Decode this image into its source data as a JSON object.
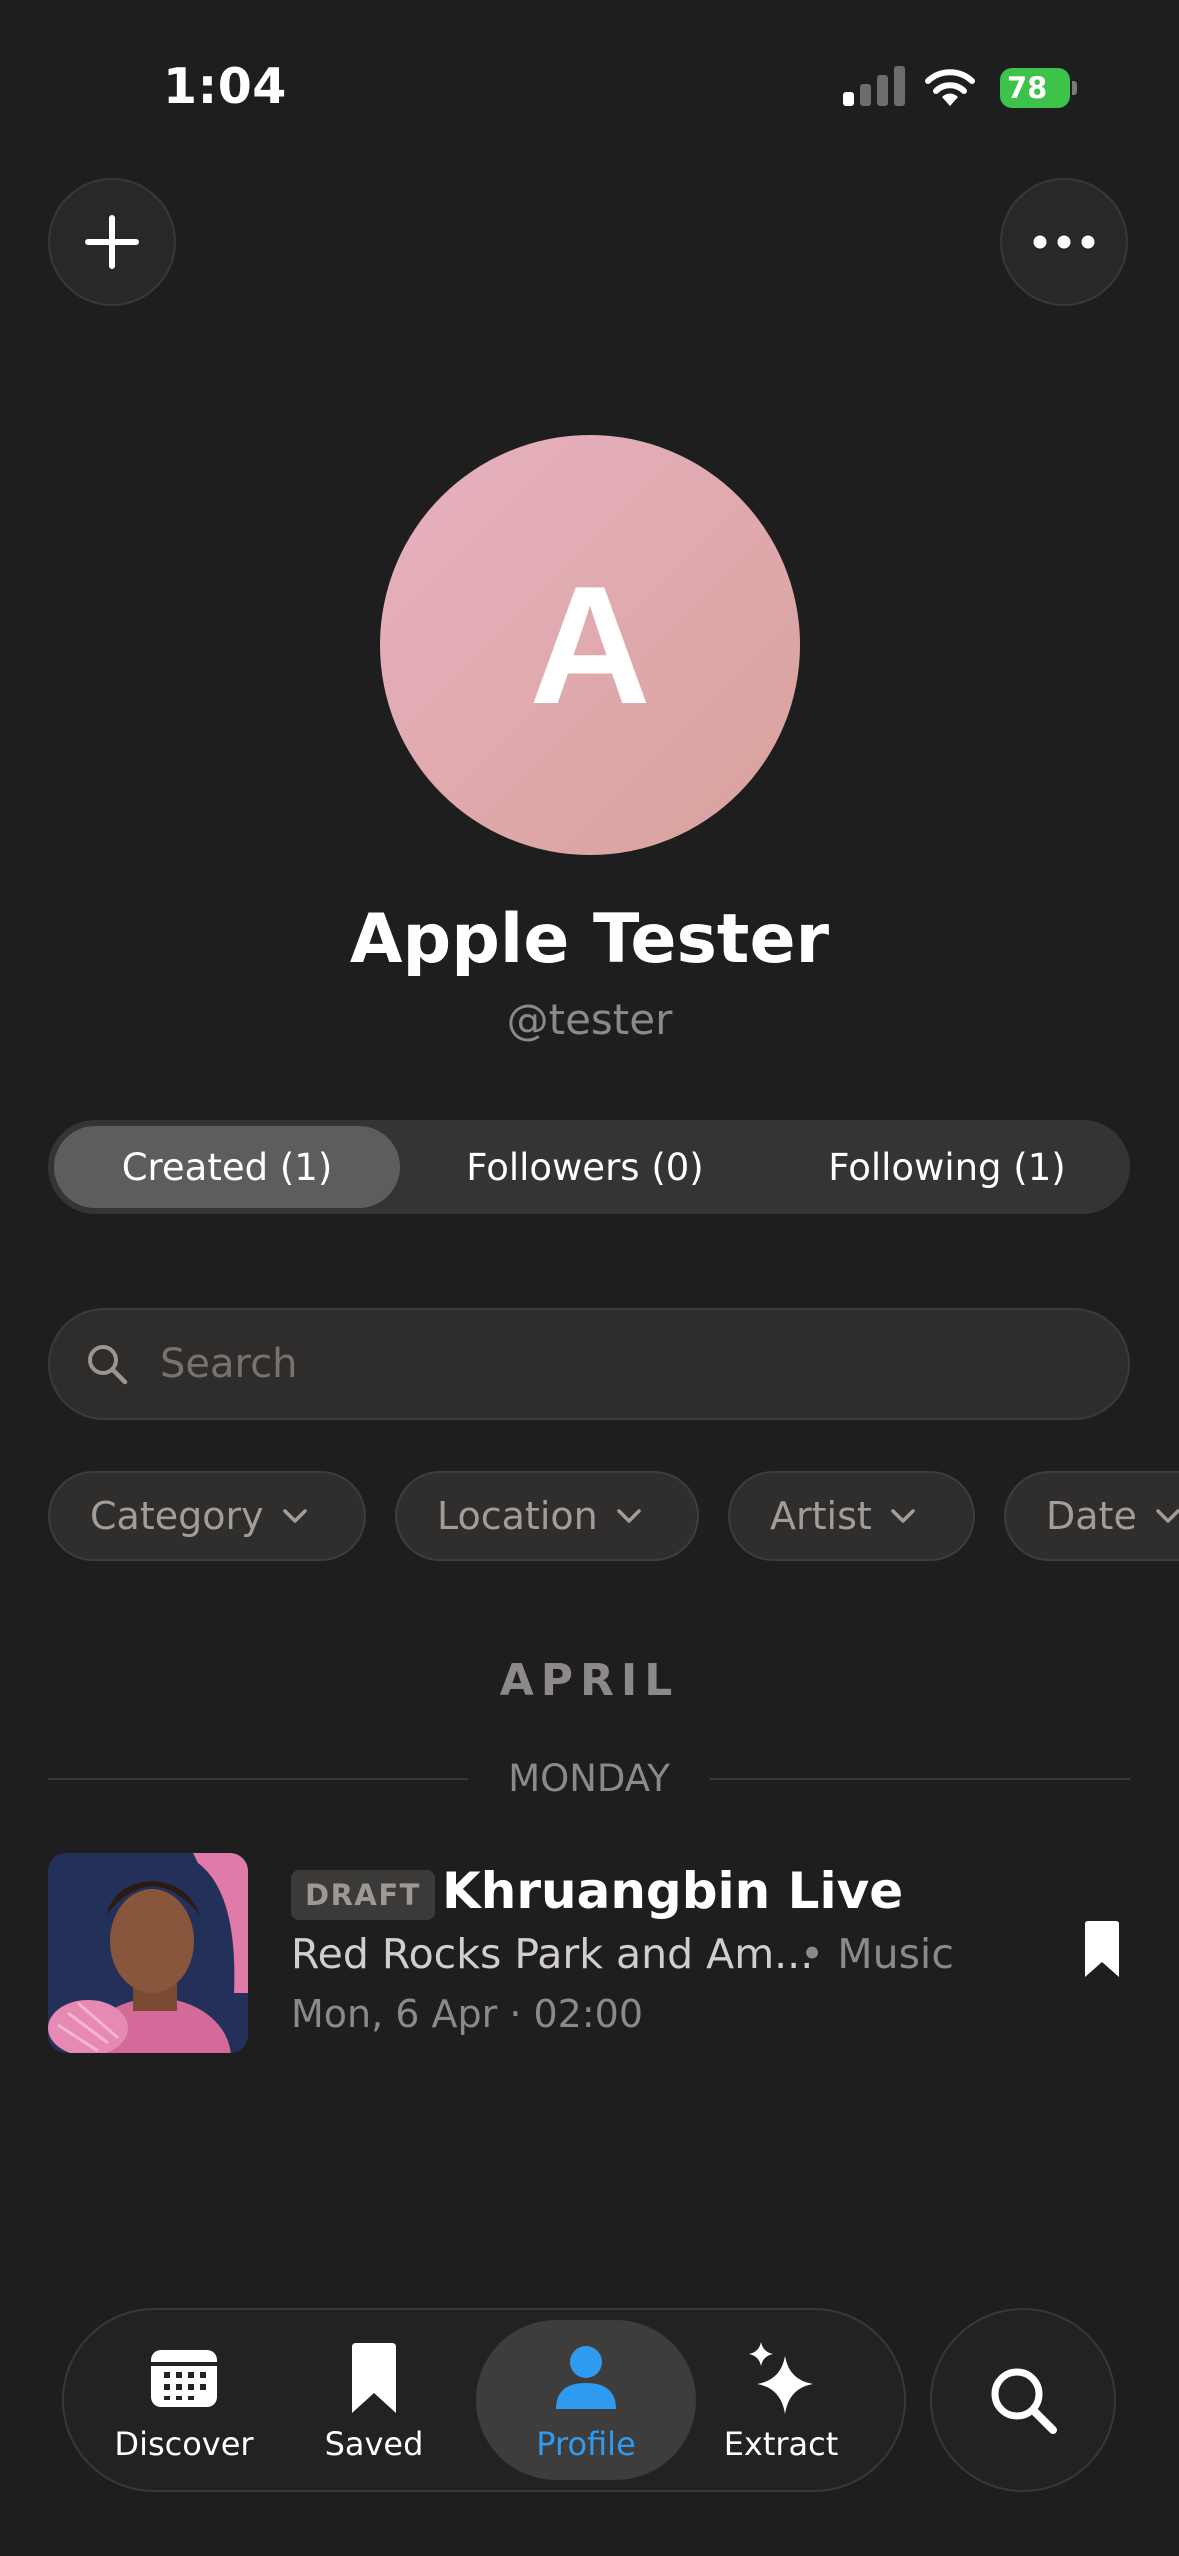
{
  "status_bar": {
    "time": "1:04",
    "battery": "78"
  },
  "profile": {
    "initial": "A",
    "name": "Apple Tester",
    "handle": "@tester"
  },
  "segments": [
    {
      "label": "Created (1)",
      "active": true
    },
    {
      "label": "Followers (0)",
      "active": false
    },
    {
      "label": "Following (1)",
      "active": false
    }
  ],
  "search": {
    "placeholder": "Search"
  },
  "filters": [
    "Category",
    "Location",
    "Artist",
    "Date"
  ],
  "list": {
    "month": "APRIL",
    "day": "MONDAY",
    "event": {
      "badge": "DRAFT",
      "title": "Khruangbin Live",
      "venue": "Red Rocks Park and Am...",
      "category": "• Music",
      "date": "Mon, 6 Apr · 02:00"
    }
  },
  "tabbar": {
    "items": [
      {
        "label": "Discover",
        "icon": "calendar-icon"
      },
      {
        "label": "Saved",
        "icon": "bookmark-icon"
      },
      {
        "label": "Profile",
        "icon": "person-icon",
        "active": true
      },
      {
        "label": "Extract",
        "icon": "sparkles-icon"
      }
    ],
    "search_icon": "search-icon"
  },
  "colors": {
    "background": "#1f1e1e",
    "accent": "#2f9bf0",
    "battery": "#3dc24a",
    "avatar_gradient": [
      "#e6b1c0",
      "#d9a29c"
    ]
  }
}
